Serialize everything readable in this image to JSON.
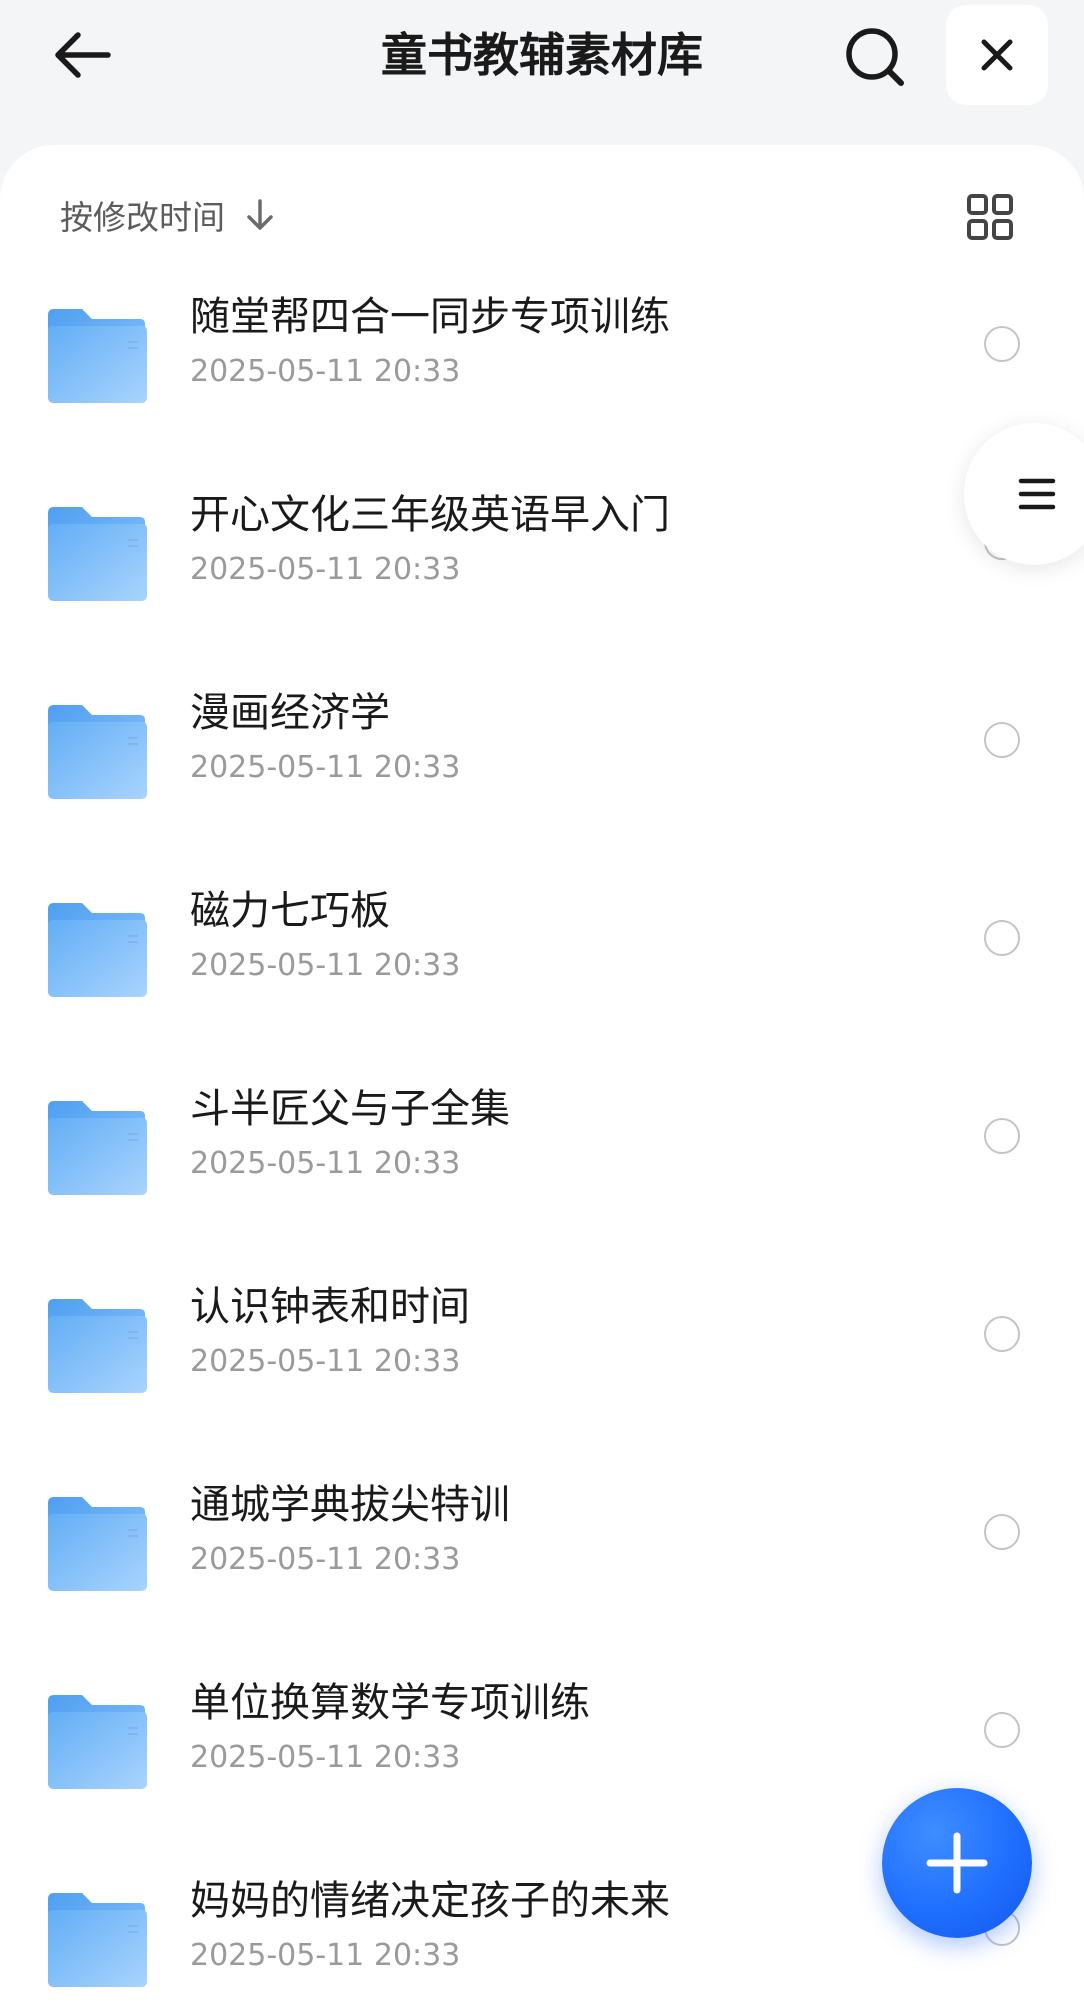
{
  "header": {
    "title": "童书教辅素材库"
  },
  "sort": {
    "label": "按修改时间"
  },
  "files": [
    {
      "name": "随堂帮四合一同步专项训练",
      "date": "2025-05-11 20:33"
    },
    {
      "name": "开心文化三年级英语早入门",
      "date": "2025-05-11 20:33"
    },
    {
      "name": "漫画经济学",
      "date": "2025-05-11 20:33"
    },
    {
      "name": "磁力七巧板",
      "date": "2025-05-11 20:33"
    },
    {
      "name": "斗半匠父与子全集",
      "date": "2025-05-11 20:33"
    },
    {
      "name": "认识钟表和时间",
      "date": "2025-05-11 20:33"
    },
    {
      "name": "通城学典拔尖特训",
      "date": "2025-05-11 20:33"
    },
    {
      "name": "单位换算数学专项训练",
      "date": "2025-05-11 20:33"
    },
    {
      "name": "妈妈的情绪决定孩子的未来",
      "date": "2025-05-11 20:33"
    }
  ],
  "icons": {
    "back": "arrow-left-icon",
    "search": "search-icon",
    "close": "close-icon",
    "sort": "arrow-down-icon",
    "view": "grid-view-icon",
    "folder": "folder-icon",
    "menu": "menu-icon",
    "add": "plus-icon"
  },
  "colors": {
    "accent": "#1f6fff",
    "folder": "#5aaaf5",
    "background": "#f4f5f7"
  }
}
